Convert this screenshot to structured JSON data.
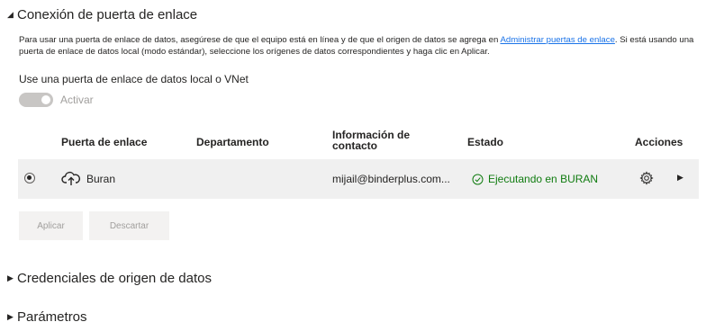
{
  "sections": {
    "gateway": {
      "title": "Conexión de puerta de enlace",
      "expanded": true
    },
    "credentials": {
      "title": "Credenciales de origen de datos",
      "expanded": false
    },
    "parameters": {
      "title": "Parámetros",
      "expanded": false
    }
  },
  "description": {
    "part1": "Para usar una puerta de enlace de datos, asegúrese de que el equipo está en línea y de que el origen de datos se agrega en ",
    "link": "Administrar puertas de enlace",
    "part2": ". Si está usando una puerta de enlace de datos local (modo estándar), seleccione los orígenes de datos correspondientes y haga clic en Aplicar."
  },
  "toggle": {
    "label": "Use una puerta de enlace de datos local o VNet",
    "text": "Activar",
    "enabled": false
  },
  "table": {
    "headers": {
      "gateway": "Puerta de enlace",
      "department": "Departamento",
      "contact": "Información de contacto",
      "status": "Estado",
      "actions": "Acciones"
    },
    "rows": [
      {
        "selected": true,
        "gateway": "Buran",
        "department": "",
        "contact": "mijail@binderplus.com...",
        "status": "Ejecutando en BURAN"
      }
    ]
  },
  "buttons": {
    "apply": "Aplicar",
    "discard": "Descartar"
  },
  "colors": {
    "status_ok": "#107c10",
    "link": "#1a73e8",
    "row_bg": "#f0f0f0",
    "disabled_text": "#a19f9d"
  }
}
